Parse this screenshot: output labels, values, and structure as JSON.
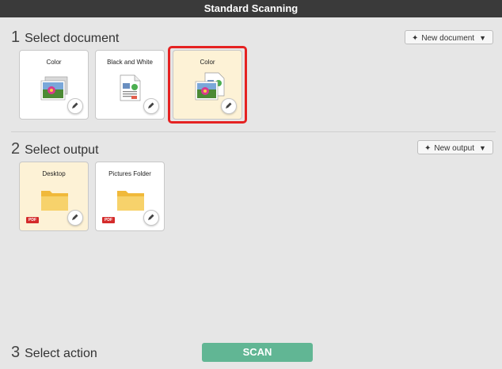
{
  "window": {
    "title": "Standard Scanning"
  },
  "document_section": {
    "number": "1",
    "title": "Select document",
    "new_button": "New document",
    "cards": [
      {
        "label": "Color",
        "icon": "color-photo-icon",
        "selected": false
      },
      {
        "label": "Black and White",
        "icon": "bw-document-icon",
        "selected": false
      },
      {
        "label": "Color",
        "icon": "color-photo-document-icon",
        "selected": true
      }
    ]
  },
  "output_section": {
    "number": "2",
    "title": "Select output",
    "new_button": "New output",
    "cards": [
      {
        "label": "Desktop",
        "icon": "folder-icon",
        "badge": "PDF",
        "selected": true
      },
      {
        "label": "Pictures Folder",
        "icon": "folder-icon",
        "badge": "PDF",
        "selected": false
      }
    ]
  },
  "action_section": {
    "number": "3",
    "title": "Select action",
    "scan_button": "SCAN"
  },
  "colors": {
    "scan": "#61b694",
    "selection_border": "#e52222",
    "selected_card": "#fdf2d6",
    "title_bar": "#3a3a3a"
  }
}
